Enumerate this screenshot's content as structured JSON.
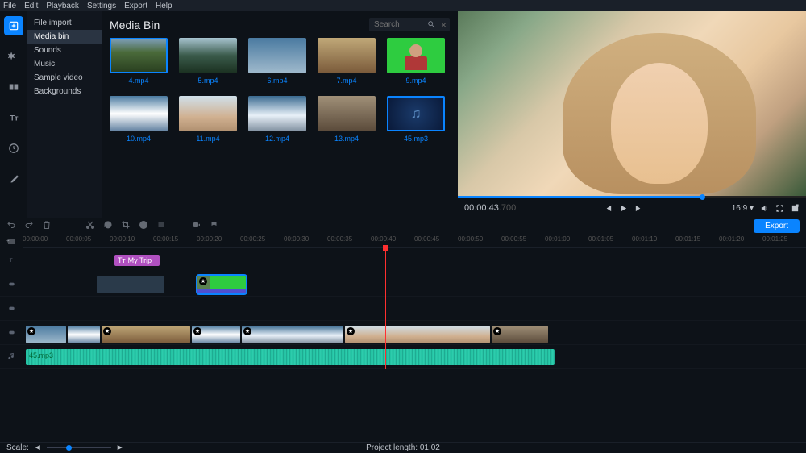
{
  "menubar": [
    "File",
    "Edit",
    "Playback",
    "Settings",
    "Export",
    "Help"
  ],
  "sidebar": {
    "items": [
      "File import",
      "Media bin",
      "Sounds",
      "Music",
      "Sample video",
      "Backgrounds"
    ],
    "active": 1
  },
  "media_bin": {
    "title": "Media Bin",
    "search_placeholder": "Search",
    "thumbs": [
      {
        "label": "4.mp4",
        "cls": "th-lake",
        "selected": true
      },
      {
        "label": "5.mp4",
        "cls": "th-kayak"
      },
      {
        "label": "6.mp4",
        "cls": "th-sky"
      },
      {
        "label": "7.mp4",
        "cls": "th-desert"
      },
      {
        "label": "9.mp4",
        "cls": "th-green"
      },
      {
        "label": "10.mp4",
        "cls": "th-mtn"
      },
      {
        "label": "11.mp4",
        "cls": "th-selfie"
      },
      {
        "label": "12.mp4",
        "cls": "th-mtn2"
      },
      {
        "label": "13.mp4",
        "cls": "th-bike"
      },
      {
        "label": "45.mp3",
        "cls": "th-audio",
        "selected": true
      }
    ]
  },
  "preview": {
    "timecode": "00:00:43",
    "timecode_ms": ".700",
    "ratio": "16:9"
  },
  "timeline": {
    "export_label": "Export",
    "title_clip": "My Trip",
    "audio_label": "45.mp3",
    "ruler": [
      "00:00:00",
      "00:00:05",
      "00:00:10",
      "00:00:15",
      "00:00:20",
      "00:00:25",
      "00:00:30",
      "00:00:35",
      "00:00:40",
      "00:00:45",
      "00:00:50",
      "00:00:55",
      "00:01:00",
      "00:01:05",
      "00:01:10",
      "00:01:15",
      "00:01:20",
      "00:01:25"
    ]
  },
  "footer": {
    "scale_label": "Scale:",
    "proj_length_label": "Project length:",
    "proj_length_value": "01:02"
  }
}
